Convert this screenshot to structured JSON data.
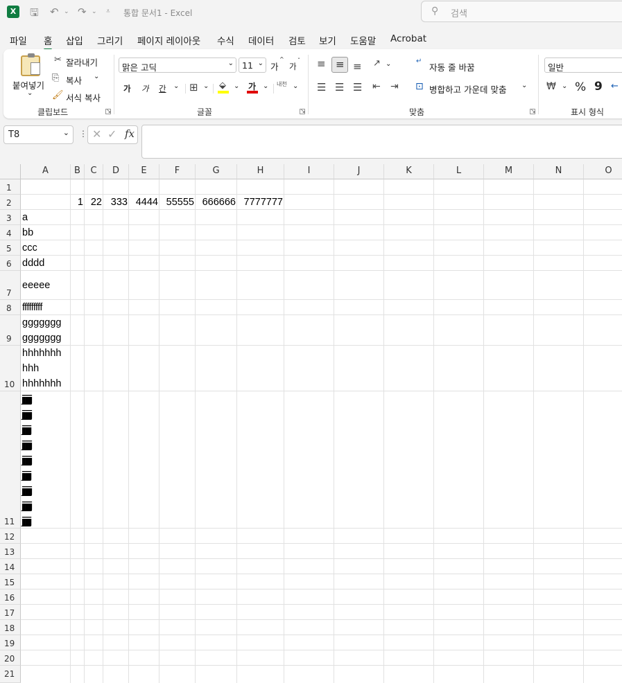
{
  "app": {
    "doc_title": "통합 문서1  -  Excel",
    "logo_letter": "X",
    "search_placeholder": "검색"
  },
  "menu_tabs": [
    "파일",
    "홈",
    "삽입",
    "그리기",
    "페이지 레이아웃",
    "수식",
    "데이터",
    "검토",
    "보기",
    "도움말",
    "Acrobat"
  ],
  "active_tab": "홈",
  "ribbon": {
    "clipboard": {
      "paste": "붙여넣기",
      "cut": "잘라내기",
      "copy": "복사",
      "format_painter": "서식 복사",
      "group_label": "클립보드"
    },
    "font": {
      "font_name": "맑은 고딕",
      "font_size": "11",
      "grow": "가",
      "shrink": "가",
      "bold": "가",
      "italic": "가",
      "underline": "간",
      "font_color_glyph": "가",
      "phonetic": "내천",
      "group_label": "글꼴"
    },
    "alignment": {
      "wrap_text": "자동 줄 바꿈",
      "merge_center": "병합하고 가운데 맞춤",
      "group_label": "맞춤"
    },
    "number": {
      "format": "일반",
      "percent": "%",
      "comma": "9",
      "group_label": "표시 형식"
    }
  },
  "formula_bar": {
    "name_box": "T8",
    "fx": "fx",
    "content": ""
  },
  "sheet": {
    "columns": [
      "A",
      "B",
      "C",
      "D",
      "E",
      "F",
      "G",
      "H",
      "I",
      "J",
      "K",
      "L",
      "M",
      "N",
      "O"
    ],
    "rows": [
      "1",
      "2",
      "3",
      "4",
      "5",
      "6",
      "7",
      "8",
      "9",
      "10",
      "11",
      "12",
      "13",
      "14",
      "15",
      "16",
      "17",
      "18",
      "19",
      "20",
      "21"
    ],
    "row2_numbers": [
      "1",
      "22",
      "333",
      "4444",
      "55555",
      "666666",
      "7777777"
    ],
    "col_a": {
      "a3": "a",
      "a4": "bb",
      "a5": "ccc",
      "a6": "dddd",
      "a7": "eeeee",
      "a8": "fffffffff",
      "a9_line1": "ggggggg",
      "a9_line2": "ggggggg",
      "a10_line1": "hhhhhhh",
      "a10_line2": "hhh",
      "a10_line3": "hhhhhhh",
      "a11_lines": [
        "jjjjjjjjjjjjjjj",
        "jjjjjjjjjjjjjjj",
        "jjjjjjjjjjjjjj",
        "jjjjjjjjjjjjjjj",
        "jjjjjjjjjjjjjjj",
        "jjjjjjjjjjjjjj",
        "jjjjjjjjjjjjjjj",
        "jjjjjjjjjjjjjjj",
        "jjjjjjjjjjjjjj"
      ]
    }
  },
  "colors": {
    "accent": "#107c41",
    "font_color": "#e00000",
    "highlight": "#ffff00"
  }
}
